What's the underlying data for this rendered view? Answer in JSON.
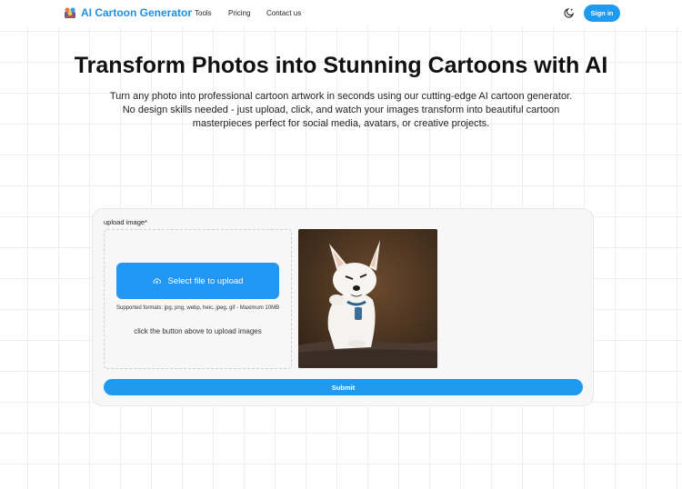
{
  "header": {
    "brand": "AI Cartoon Generator",
    "nav": [
      "Tools",
      "Pricing",
      "Contact us"
    ],
    "sign_in": "Sign in"
  },
  "hero": {
    "title": "Transform Photos into Stunning Cartoons with AI",
    "description": "Turn any photo into professional cartoon artwork in seconds using our cutting-edge AI cartoon generator. No design skills needed - just upload, click, and watch your images transform into beautiful cartoon masterpieces perfect for social media, avatars, or creative projects."
  },
  "upload": {
    "label": "upload image*",
    "select_button": "Select file to upload",
    "formats": "Supported formats: jpg, png, webp, heic, jpeg, gif - Maximum 10MB",
    "hint": "click the button above to upload images",
    "submit": "Submit"
  },
  "icons": {
    "brand": "cartoon-logo-icon",
    "theme": "moon-icon",
    "upload": "cloud-upload-icon"
  },
  "colors": {
    "accent": "#1e9bf0",
    "brand_text": "#1e8fe3",
    "card_bg": "#f7f7f7"
  }
}
